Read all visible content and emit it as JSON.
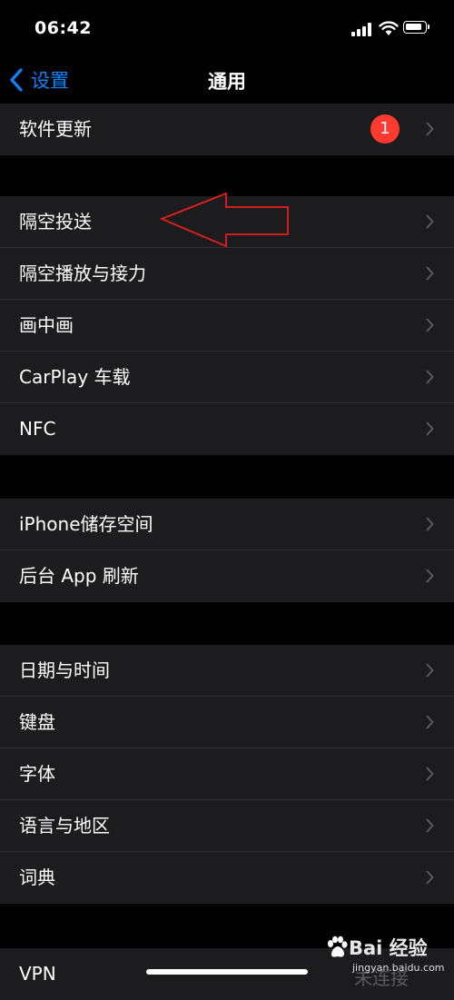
{
  "status_bar": {
    "time": "06:42"
  },
  "nav": {
    "back_label": "设置",
    "title": "通用"
  },
  "groups": [
    {
      "items": [
        {
          "label": "软件更新",
          "badge": "1"
        }
      ]
    },
    {
      "items": [
        {
          "label": "隔空投送"
        },
        {
          "label": "隔空播放与接力"
        },
        {
          "label": "画中画"
        },
        {
          "label": "CarPlay 车载"
        },
        {
          "label": "NFC"
        }
      ]
    },
    {
      "items": [
        {
          "label": "iPhone储存空间"
        },
        {
          "label": "后台 App 刷新"
        }
      ]
    },
    {
      "items": [
        {
          "label": "日期与时间"
        },
        {
          "label": "键盘"
        },
        {
          "label": "字体"
        },
        {
          "label": "语言与地区"
        },
        {
          "label": "词典"
        }
      ]
    },
    {
      "items": [
        {
          "label": "VPN",
          "value": "未连接"
        }
      ]
    }
  ],
  "watermark": {
    "brand": "Bai  经验",
    "url": "jingyan.baidu.com"
  },
  "colors": {
    "accent": "#0a84ff",
    "badge": "#ff3b30",
    "annotation": "#e0201c"
  }
}
